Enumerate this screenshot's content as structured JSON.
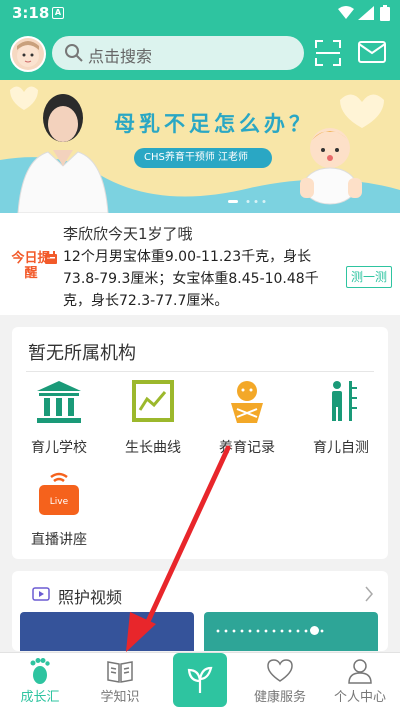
{
  "statusbar": {
    "time": "3:18",
    "notif_glyph": "A"
  },
  "header": {
    "search_placeholder": "点击搜索"
  },
  "banner": {
    "title": "母乳不足怎么办？",
    "doctor": "CHS养育干预师  江老师"
  },
  "tip": {
    "badge": "今日提醒",
    "headline": "李欣欣今天1岁了哦",
    "body": "12个月男宝体重9.00-11.23千克，身长73.8-79.3厘米；女宝体重8.45-10.48千克，身长72.3-77.7厘米。",
    "button": "测一测"
  },
  "institution": {
    "title": "暂无所属机构",
    "items": [
      {
        "label": "育儿学校",
        "icon": "school-icon"
      },
      {
        "label": "生长曲线",
        "icon": "growth-chart-icon"
      },
      {
        "label": "养育记录",
        "icon": "baby-record-icon"
      },
      {
        "label": "育儿自测",
        "icon": "self-test-icon"
      },
      {
        "label": "直播讲座",
        "icon": "live-lecture-icon"
      }
    ]
  },
  "videos": {
    "title": "照护视频"
  },
  "tabbar": {
    "items": [
      {
        "label": "成长汇",
        "icon": "footprint-icon",
        "active": true
      },
      {
        "label": "学知识",
        "icon": "book-icon",
        "active": false
      },
      {
        "label": "",
        "icon": "sprout-icon",
        "active": false
      },
      {
        "label": "健康服务",
        "icon": "heart-icon",
        "active": false
      },
      {
        "label": "个人中心",
        "icon": "person-icon",
        "active": false
      }
    ]
  },
  "colors": {
    "primary": "#2ec4a0",
    "alert": "#f25a2a",
    "institution_icon": "#1a9a78",
    "growth_icon": "#9cb82c",
    "record_icon": "#f3a828",
    "live_icon": "#f5621c",
    "annotation_arrow": "#e8262b"
  }
}
